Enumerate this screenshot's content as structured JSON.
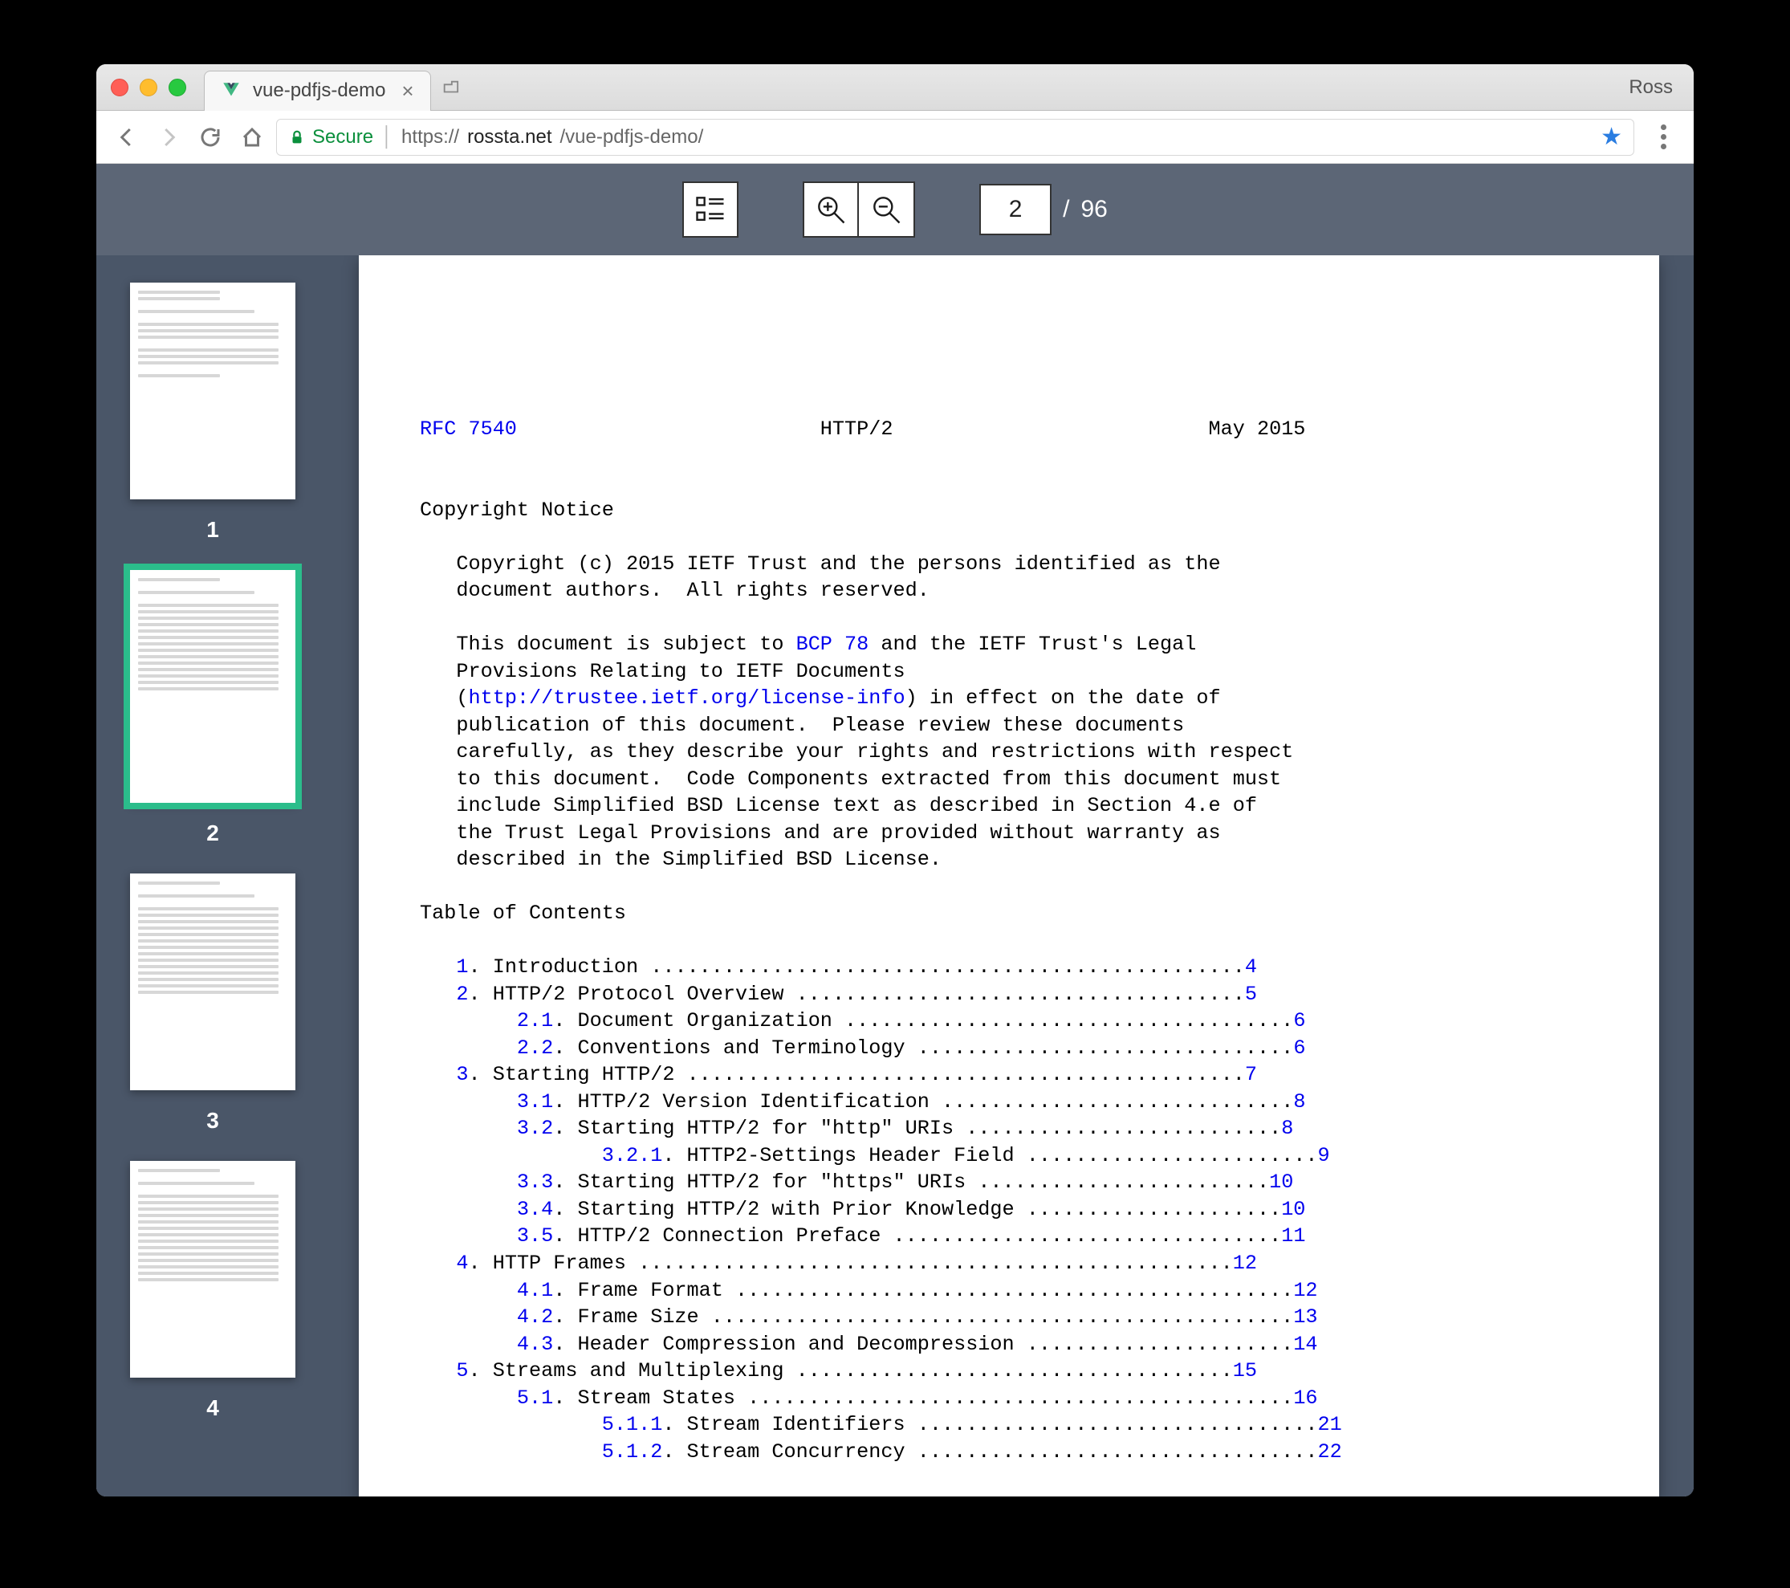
{
  "browser": {
    "tab_title": "vue-pdfjs-demo",
    "profile": "Ross",
    "secure_label": "Secure",
    "url_scheme": "https://",
    "url_host": "rossta.net",
    "url_path": "/vue-pdfjs-demo/"
  },
  "toolbar": {
    "current_page": "2",
    "total_pages": "96",
    "sep": "/"
  },
  "thumbnails": [
    {
      "label": "1",
      "active": false
    },
    {
      "label": "2",
      "active": true
    },
    {
      "label": "3",
      "active": false
    },
    {
      "label": "4",
      "active": false
    }
  ],
  "doc": {
    "header_left_link": "RFC 7540",
    "header_center": "HTTP/2",
    "header_right": "May 2015",
    "copyright_heading": "Copyright Notice",
    "copyright_p1a": "   Copyright (c) 2015 IETF Trust and the persons identified as the",
    "copyright_p1b": "   document authors.  All rights reserved.",
    "copyright_p2a": "   This document is subject to ",
    "bcp78": "BCP 78",
    "copyright_p2b": " and the IETF Trust's Legal",
    "copyright_p2c": "   Provisions Relating to IETF Documents",
    "copyright_p2d": "   (",
    "license_url": "http://trustee.ietf.org/license-info",
    "copyright_p2e": ") in effect on the date of",
    "copyright_p2f": "   publication of this document.  Please review these documents",
    "copyright_p2g": "   carefully, as they describe your rights and restrictions with respect",
    "copyright_p2h": "   to this document.  Code Components extracted from this document must",
    "copyright_p2i": "   include Simplified BSD License text as described in Section 4.e of",
    "copyright_p2j": "   the Trust Legal Provisions and are provided without warranty as",
    "copyright_p2k": "   described in the Simplified BSD License.",
    "toc_heading": "Table of Contents",
    "toc": [
      {
        "num": "1",
        "title": "Introduction",
        "dots": 49,
        "page": "4",
        "indent": 3
      },
      {
        "num": "2",
        "title": "HTTP/2 Protocol Overview",
        "dots": 37,
        "page": "5",
        "indent": 3
      },
      {
        "num": "2.1",
        "title": "Document Organization",
        "dots": 37,
        "page": "6",
        "indent": 8
      },
      {
        "num": "2.2",
        "title": "Conventions and Terminology",
        "dots": 31,
        "page": "6",
        "indent": 8
      },
      {
        "num": "3",
        "title": "Starting HTTP/2",
        "dots": 46,
        "page": "7",
        "indent": 3
      },
      {
        "num": "3.1",
        "title": "HTTP/2 Version Identification",
        "dots": 29,
        "page": "8",
        "indent": 8
      },
      {
        "num": "3.2",
        "title": "Starting HTTP/2 for \"http\" URIs",
        "dots": 26,
        "page": "8",
        "indent": 8
      },
      {
        "num": "3.2.1",
        "title": "HTTP2-Settings Header Field",
        "dots": 24,
        "page": "9",
        "indent": 15
      },
      {
        "num": "3.3",
        "title": "Starting HTTP/2 for \"https\" URIs",
        "dots": 24,
        "page": "10",
        "indent": 8
      },
      {
        "num": "3.4",
        "title": "Starting HTTP/2 with Prior Knowledge",
        "dots": 21,
        "page": "10",
        "indent": 8
      },
      {
        "num": "3.5",
        "title": "HTTP/2 Connection Preface",
        "dots": 32,
        "page": "11",
        "indent": 8
      },
      {
        "num": "4",
        "title": "HTTP Frames",
        "dots": 49,
        "page": "12",
        "indent": 3
      },
      {
        "num": "4.1",
        "title": "Frame Format",
        "dots": 46,
        "page": "12",
        "indent": 8
      },
      {
        "num": "4.2",
        "title": "Frame Size",
        "dots": 48,
        "page": "13",
        "indent": 8
      },
      {
        "num": "4.3",
        "title": "Header Compression and Decompression",
        "dots": 22,
        "page": "14",
        "indent": 8
      },
      {
        "num": "5",
        "title": "Streams and Multiplexing",
        "dots": 36,
        "page": "15",
        "indent": 3
      },
      {
        "num": "5.1",
        "title": "Stream States",
        "dots": 45,
        "page": "16",
        "indent": 8
      },
      {
        "num": "5.1.1",
        "title": "Stream Identifiers",
        "dots": 33,
        "page": "21",
        "indent": 15
      },
      {
        "num": "5.1.2",
        "title": "Stream Concurrency",
        "dots": 33,
        "page": "22",
        "indent": 15
      }
    ]
  }
}
